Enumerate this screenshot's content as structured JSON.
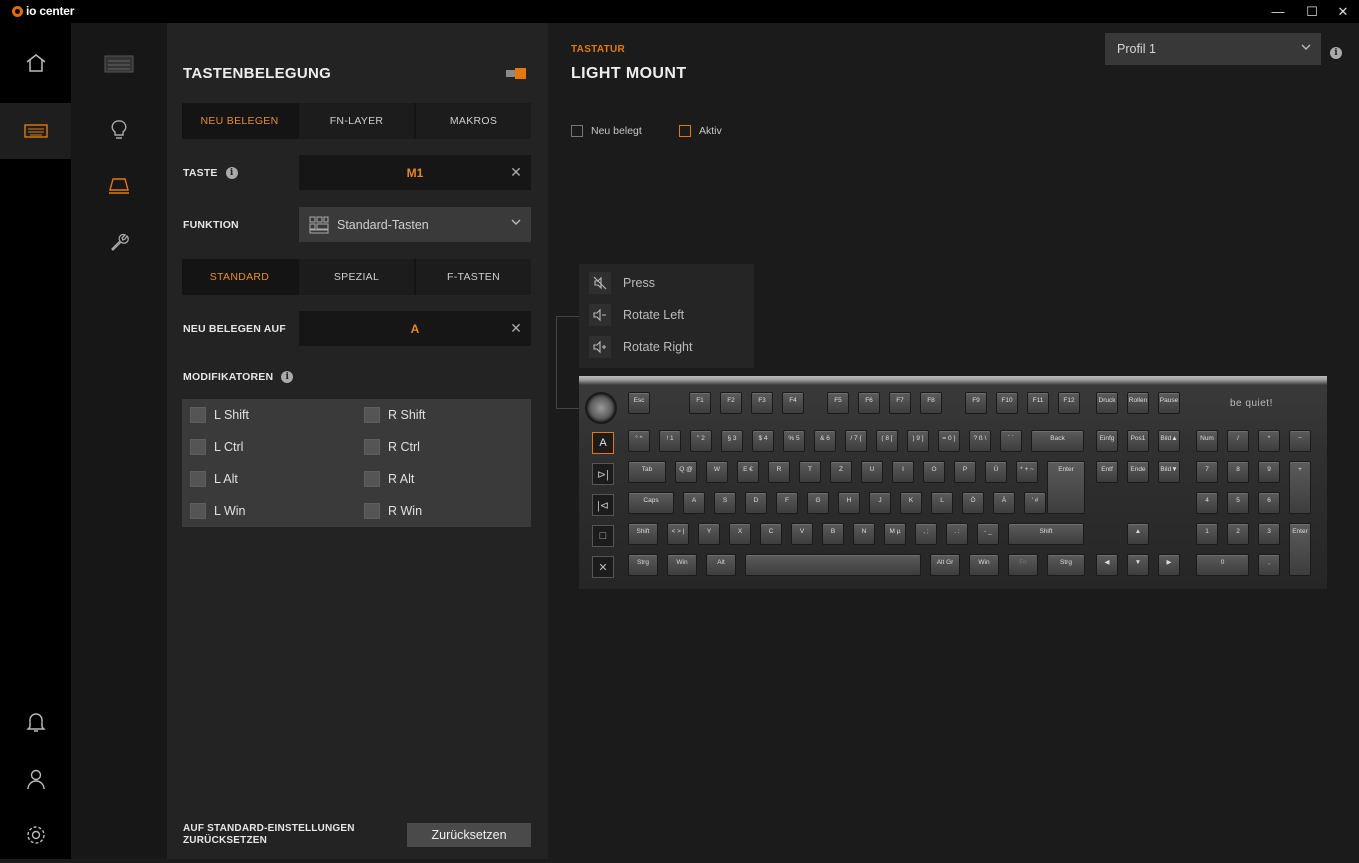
{
  "app": {
    "title": "io center"
  },
  "window": {
    "minimize": "—",
    "maximize": "☐",
    "close": "✕"
  },
  "panel": {
    "title": "TASTENBELEGUNG",
    "tabs1": [
      {
        "label": "NEU BELEGEN",
        "active": true
      },
      {
        "label": "FN-LAYER",
        "active": false
      },
      {
        "label": "MAKROS",
        "active": false
      }
    ],
    "taste_label": "TASTE",
    "taste_value": "M1",
    "funktion_label": "FUNKTION",
    "funktion_value": "Standard-Tasten",
    "tabs2": [
      {
        "label": "STANDARD",
        "active": true
      },
      {
        "label": "SPEZIAL",
        "active": false
      },
      {
        "label": "F-TASTEN",
        "active": false
      }
    ],
    "neu_belegen_label": "NEU BELEGEN AUF",
    "neu_belegen_value": "A",
    "modifikatoren_label": "MODIFIKATOREN",
    "modifiers": [
      "L Shift",
      "R Shift",
      "L Ctrl",
      "R Ctrl",
      "L Alt",
      "R Alt",
      "L Win",
      "R Win"
    ],
    "reset_label": "AUF STANDARD-EINSTELLUNGEN ZURÜCKSETZEN",
    "reset_button": "Zurücksetzen",
    "info_glyph": "i"
  },
  "main": {
    "category": "TASTATUR",
    "device_name": "LIGHT MOUNT",
    "profile": "Profil 1",
    "legend": [
      {
        "label": "Neu belegt",
        "color": "#777777"
      },
      {
        "label": "Aktiv",
        "color": "#e3790e"
      }
    ],
    "knob_menu": [
      {
        "label": "Press",
        "icon": "mute-icon"
      },
      {
        "label": "Rotate Left",
        "icon": "volume-down-icon"
      },
      {
        "label": "Rotate Right",
        "icon": "volume-up-icon"
      }
    ],
    "macro_keys": [
      "A",
      "⊳|",
      "|⊲",
      "□",
      "✕"
    ],
    "keyboard_brand": "be quiet!",
    "rows": {
      "r0": [
        "Esc",
        "F1",
        "F2",
        "F3",
        "F4",
        "F5",
        "F6",
        "F7",
        "F8",
        "F9",
        "F10",
        "F11",
        "F12",
        "Druck",
        "Rollen",
        "Pause"
      ],
      "r1": [
        "° ^",
        "! 1",
        "\" 2",
        "§ 3",
        "$ 4",
        "% 5",
        "& 6",
        "/ 7 {",
        "( 8 [",
        ") 9 ]",
        "= 0 }",
        "? ß \\",
        "` ´",
        "Back",
        "Einfg",
        "Pos1",
        "Bild▲",
        "Num",
        "/",
        "*",
        "−"
      ],
      "r2": [
        "Tab",
        "Q @",
        "W",
        "E €",
        "R",
        "T",
        "Z",
        "U",
        "I",
        "O",
        "P",
        "Ü",
        "* + ~",
        "Enter",
        "Entf",
        "Ende",
        "Bild▼",
        "7",
        "8",
        "9",
        "+"
      ],
      "r3": [
        "Caps",
        "A",
        "S",
        "D",
        "F",
        "G",
        "H",
        "J",
        "K",
        "L",
        "Ö",
        "Ä",
        "' #",
        "4",
        "5",
        "6"
      ],
      "r4": [
        "Shift",
        "< > |",
        "Y",
        "X",
        "C",
        "V",
        "B",
        "N",
        "M µ",
        ", ;",
        ". :",
        "- _",
        "Shift",
        "▲",
        "1",
        "2",
        "3",
        "Enter"
      ],
      "r5": [
        "Strg",
        "Win",
        "Alt",
        "",
        "Alt Gr",
        "Win",
        "Fn",
        "Strg",
        "◀",
        "▼",
        "▶",
        "0",
        ","
      ]
    }
  }
}
